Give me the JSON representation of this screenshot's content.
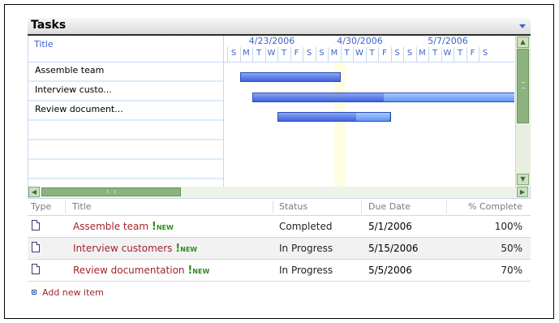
{
  "webpart": {
    "title": "Tasks"
  },
  "gantt": {
    "title_header": "Title",
    "weeks": [
      "4/23/2006",
      "4/30/2006",
      "5/7/2006"
    ],
    "day_letters": [
      "S",
      "M",
      "T",
      "W",
      "T",
      "F",
      "S",
      "S",
      "M",
      "T",
      "W",
      "T",
      "F",
      "S",
      "S",
      "M",
      "T",
      "W",
      "T",
      "F",
      "S"
    ],
    "rows": [
      "Assemble team",
      "Interview custo...",
      "Review document..."
    ],
    "bars": [
      {
        "start": "4/24/2006",
        "end": "5/1/2006",
        "percent_complete": 100
      },
      {
        "start": "4/25/2006",
        "end": "5/15/2006",
        "percent_complete": 50
      },
      {
        "start": "4/27/2006",
        "end": "5/5/2006",
        "percent_complete": 70
      }
    ]
  },
  "list": {
    "columns": {
      "type": "Type",
      "title": "Title",
      "status": "Status",
      "due": "Due Date",
      "pct": "% Complete"
    },
    "new_badge": "NEW",
    "items": [
      {
        "title": "Assemble team",
        "status": "Completed",
        "due": "5/1/2006",
        "pct": "100%"
      },
      {
        "title": "Interview customers",
        "status": "In Progress",
        "due": "5/15/2006",
        "pct": "50%"
      },
      {
        "title": "Review documentation",
        "status": "In Progress",
        "due": "5/5/2006",
        "pct": "70%"
      }
    ],
    "add_new_label": "Add new item"
  },
  "colors": {
    "accent": "#3a64c8",
    "link": "#a0242a",
    "new": "#2f8b1f",
    "scrollbar": "#8cb37d"
  }
}
